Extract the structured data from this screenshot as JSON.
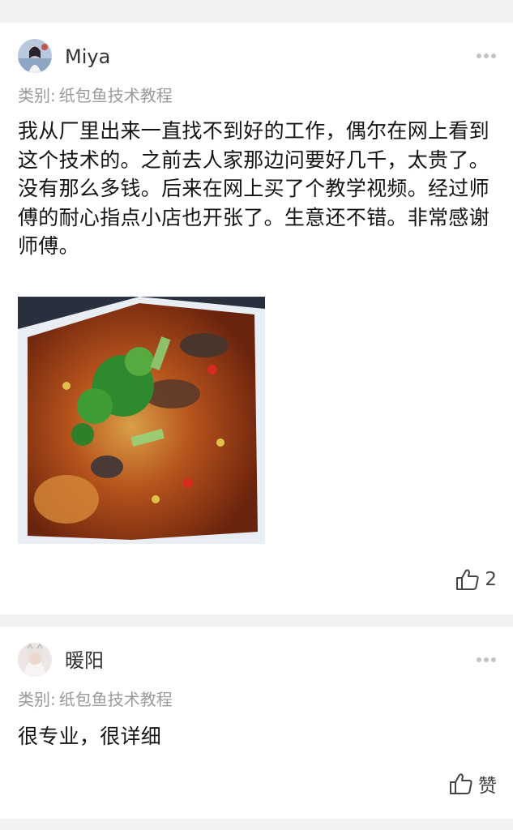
{
  "comments": [
    {
      "username": "Miya",
      "category_label": "类别:",
      "category_value": "纸包鱼技术教程",
      "text": "我从厂里出来一直找不到好的工作，偶尔在网上看到这个技术的。之前去人家那边问要好几千，太贵了。没有那么多钱。后来在网上买了个教学视频。经过师傅的耐心指点小店也开张了。生意还不错。非常感谢师傅。",
      "likes": "2"
    },
    {
      "username": "暖阳",
      "category_label": "类别:",
      "category_value": "纸包鱼技术教程",
      "text": "很专业，很详细",
      "likes": "赞"
    }
  ]
}
